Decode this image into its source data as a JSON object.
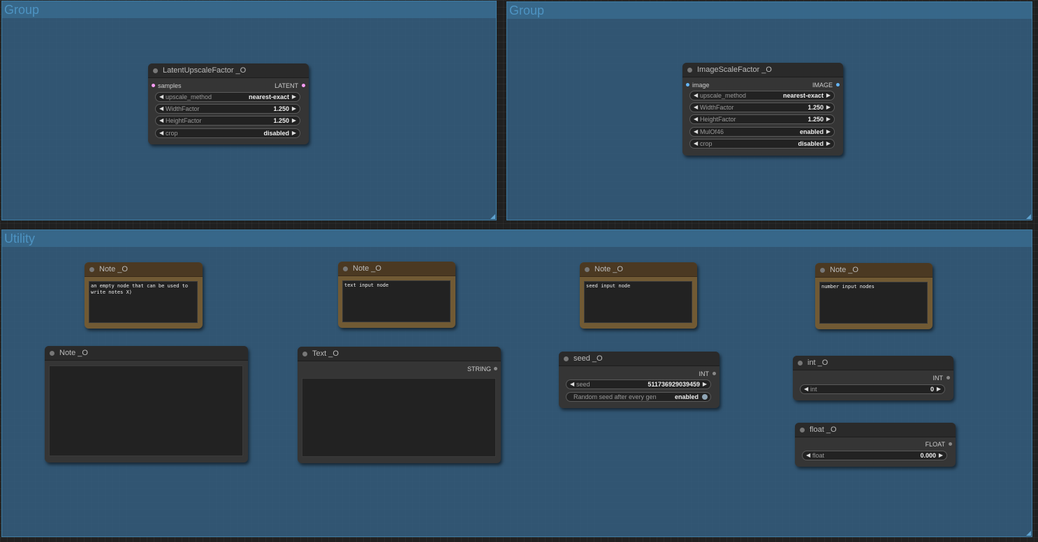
{
  "groups": [
    {
      "title": "Group"
    },
    {
      "title": "Group"
    },
    {
      "title": "Utility"
    }
  ],
  "colors": {
    "group_bg": "#335c7d",
    "group_title": "#4d93c2",
    "node_bg": "#353535",
    "note_bg": "#715a34",
    "slot_latent": "#ff9cf9",
    "slot_image": "#64b5f6"
  },
  "nodes": {
    "latent_upscale": {
      "title": "LatentUpscaleFactor _O",
      "input": "samples",
      "output": "LATENT",
      "widgets": [
        {
          "name": "upscale_method",
          "value": "nearest-exact"
        },
        {
          "name": "WidthFactor",
          "value": "1.250"
        },
        {
          "name": "HeightFactor",
          "value": "1.250"
        },
        {
          "name": "crop",
          "value": "disabled"
        }
      ]
    },
    "image_scale": {
      "title": "ImageScaleFactor _O",
      "input": "image",
      "output": "IMAGE",
      "widgets": [
        {
          "name": "upscale_method",
          "value": "nearest-exact"
        },
        {
          "name": "WidthFactor",
          "value": "1.250"
        },
        {
          "name": "HeightFactor",
          "value": "1.250"
        },
        {
          "name": "MulOf46",
          "value": "enabled"
        },
        {
          "name": "crop",
          "value": "disabled"
        }
      ]
    },
    "note1": {
      "title": "Note _O",
      "text": "an empty node that can be used to\nwrite notes X)"
    },
    "note2": {
      "title": "Note _O",
      "text": "text input node"
    },
    "note3": {
      "title": "Note _O",
      "text": "seed input node"
    },
    "note4": {
      "title": "Note _O",
      "text": "number input nodes"
    },
    "note_empty": {
      "title": "Note _O",
      "text": ""
    },
    "text_node": {
      "title": "Text _O",
      "output": "STRING",
      "text": ""
    },
    "seed_node": {
      "title": "seed _O",
      "output": "INT",
      "widget": {
        "name": "seed",
        "value": "511736929039459"
      },
      "toggle": {
        "name": "Random seed after every gen",
        "value": "enabled"
      }
    },
    "int_node": {
      "title": "int _O",
      "output": "INT",
      "widget": {
        "name": "int",
        "value": "0"
      }
    },
    "float_node": {
      "title": "float _O",
      "output": "FLOAT",
      "widget": {
        "name": "float",
        "value": "0.000"
      }
    }
  },
  "icons": {
    "arrow_left": "◀",
    "arrow_right": "▶"
  }
}
